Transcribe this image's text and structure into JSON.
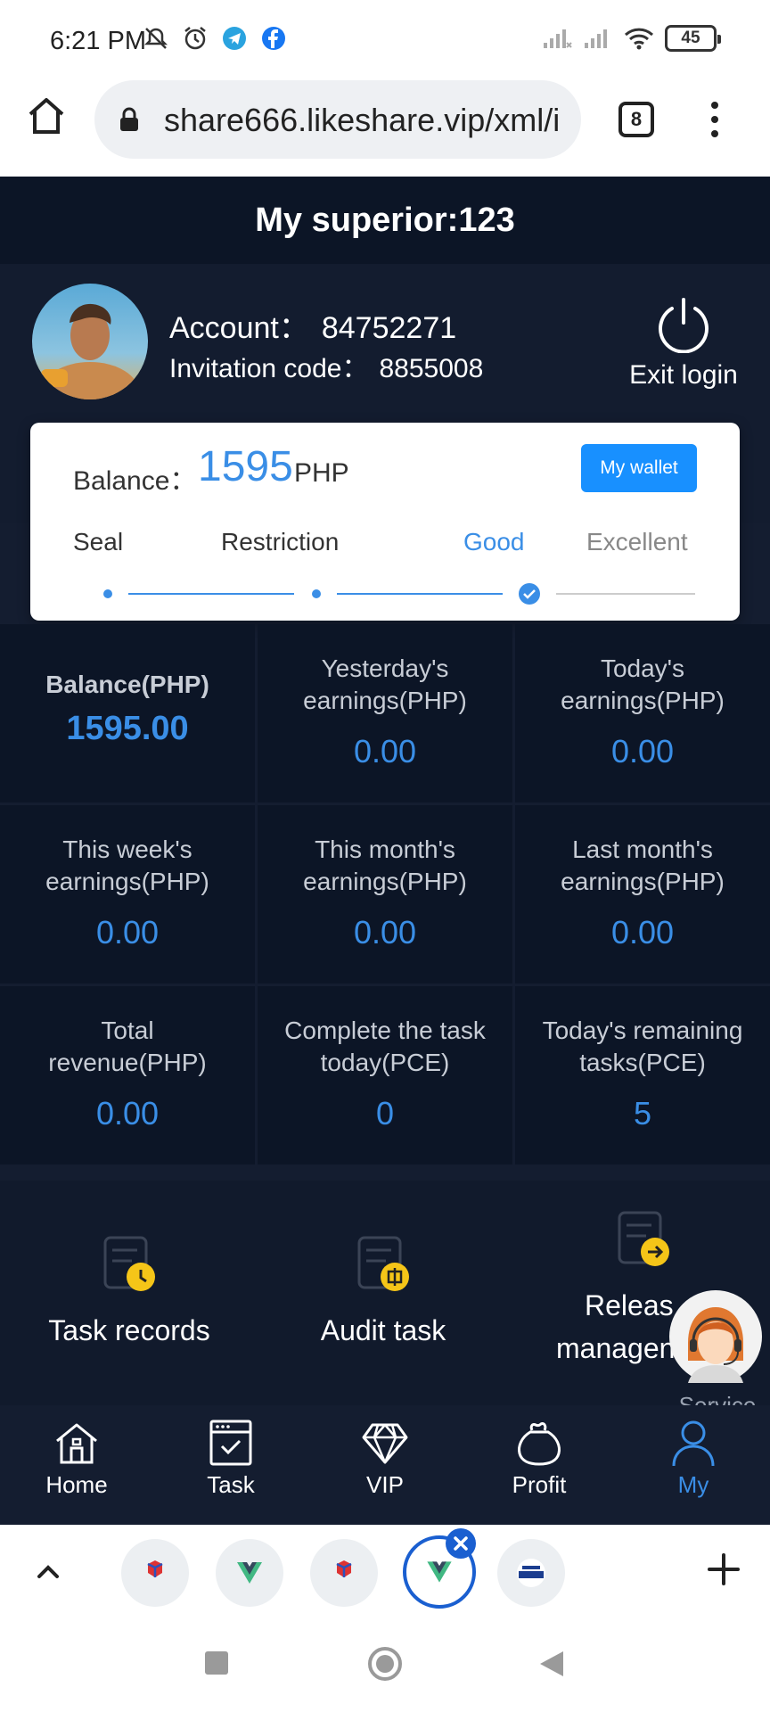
{
  "status_bar": {
    "time": "6:21 PM",
    "battery": "45",
    "icons_left": [
      "mute-bell-icon",
      "alarm-icon",
      "telegram-icon",
      "facebook-icon"
    ],
    "icons_right": [
      "signal-icon",
      "signal-icon",
      "wifi-icon",
      "battery-icon"
    ]
  },
  "browser": {
    "url": "share666.likeshare.vip/xml/i",
    "tab_count": "8",
    "icons": [
      "home-icon",
      "lock-icon",
      "more-menu-icon"
    ]
  },
  "header": {
    "superior_label": "My superior:",
    "superior_value": "123"
  },
  "profile": {
    "account_label": "Account：",
    "account_value": "84752271",
    "invitation_label": "Invitation code：",
    "invitation_value": "8855008",
    "exit_label": "Exit login"
  },
  "balance_card": {
    "label": "Balance：",
    "amount": "1595",
    "currency": "PHP",
    "wallet_button": "My wallet",
    "levels": [
      "Seal",
      "Restriction",
      "Good",
      "Excellent"
    ],
    "current_level": "Good"
  },
  "stats": [
    {
      "title": "Balance(PHP)",
      "value": "1595.00"
    },
    {
      "title": "Yesterday's earnings(PHP)",
      "value": "0.00"
    },
    {
      "title": "Today's earnings(PHP)",
      "value": "0.00"
    },
    {
      "title": "This week's earnings(PHP)",
      "value": "0.00"
    },
    {
      "title": "This month's earnings(PHP)",
      "value": "0.00"
    },
    {
      "title": "Last month's earnings(PHP)",
      "value": "0.00"
    },
    {
      "title": "Total revenue(PHP)",
      "value": "0.00"
    },
    {
      "title": "Complete the task today(PCE)",
      "value": "0"
    },
    {
      "title": "Today's remaining tasks(PCE)",
      "value": "5"
    }
  ],
  "stat_lines": {
    "s1a": "Yesterday's",
    "s1b": "earnings(PHP)",
    "s2a": "Today's",
    "s2b": "earnings(PHP)",
    "s3a": "This week's",
    "s3b": "earnings(PHP)",
    "s4a": "This month's",
    "s4b": "earnings(PHP)",
    "s5a": "Last month's",
    "s5b": "earnings(PHP)",
    "s6a": "Total",
    "s6b": "revenue(PHP)",
    "s7a": "Complete the task",
    "s7b": "today(PCE)",
    "s8a": "Today's remaining",
    "s8b": "tasks(PCE)"
  },
  "shortcuts": {
    "task_records": "Task records",
    "audit_task": "Audit task",
    "release_line1": "Releas",
    "release_line2": "managen"
  },
  "service_label": "Service",
  "bottom_nav": {
    "home": "Home",
    "task": "Task",
    "vip": "VIP",
    "profit": "Profit",
    "my": "My",
    "active": "My"
  },
  "accent_color": "#3a8ee6",
  "wallet_button_color": "#1890ff"
}
